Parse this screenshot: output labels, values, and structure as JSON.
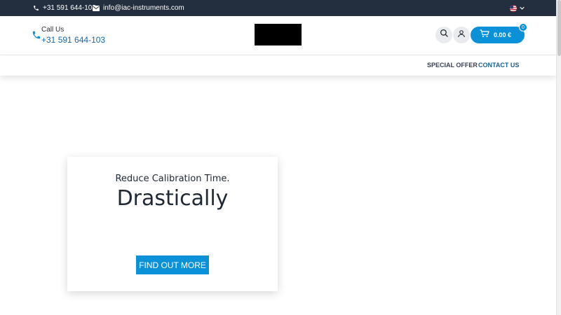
{
  "topbar": {
    "phone": "+31 591 644-103",
    "email": "info@iac-instruments.com",
    "language_flag": "us-flag-icon"
  },
  "header": {
    "call_label": "Call Us",
    "call_number": "+31 591 644-103",
    "cart_amount": "0.00 €",
    "cart_count": "0"
  },
  "nav": {
    "items": [
      {
        "label": "SPECIAL OFFER"
      },
      {
        "label": "CONTACT US"
      }
    ]
  },
  "hero": {
    "subtitle": "Reduce Calibration Time.",
    "title": "Drastically",
    "button_label": "FIND OUT MORE"
  },
  "colors": {
    "topbar_bg": "#232f3e",
    "accent": "#0a91d8",
    "link_blue": "#1b66a3"
  }
}
